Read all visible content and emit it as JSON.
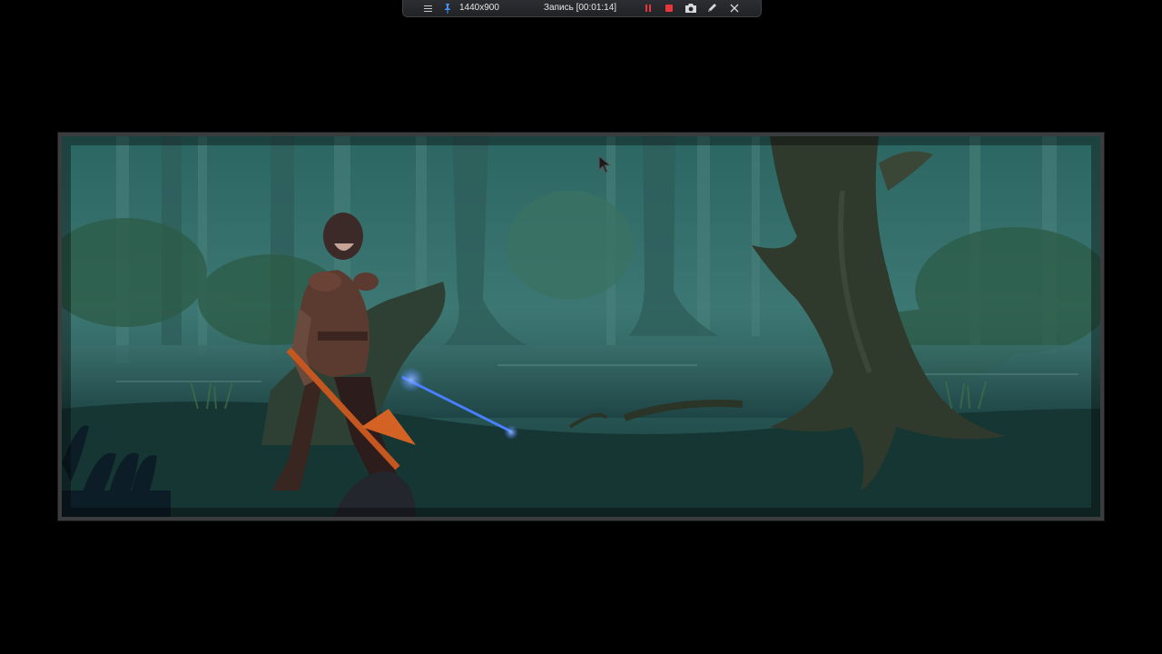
{
  "recorder": {
    "resolution": "1440x900",
    "status": "Запись [00:01:14]",
    "menu_icon": "hamburger-menu-icon",
    "pin_icon": "pin-icon",
    "pause_icon": "pause-icon",
    "stop_icon": "stop-icon",
    "camera_icon": "camera-icon",
    "pencil_icon": "pencil-icon",
    "close_icon": "close-icon",
    "accent_color": "#e8363b"
  },
  "scene": {
    "palette": {
      "mist": "#3f7a76",
      "deep": "#0f2e30",
      "tree": "#2f3a2c",
      "armor": "#5b3a30",
      "sword_glow": "#4a7dff",
      "weapon": "#c4561f"
    }
  }
}
